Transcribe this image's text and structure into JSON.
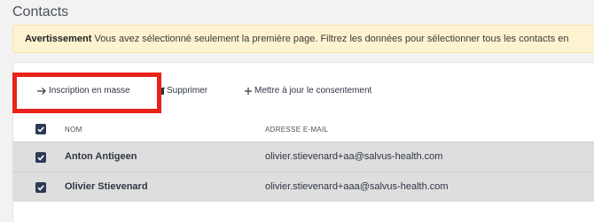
{
  "page": {
    "title": "Contacts"
  },
  "warning": {
    "label": "Avertissement",
    "message": " Vous avez sélectionné seulement la première page. Filtrez les données pour sélectionner tous les contacts en"
  },
  "toolbar": {
    "bulk_enroll": "Inscription en masse",
    "delete": "Supprimer",
    "update_consent": "Mettre à jour le consentement"
  },
  "table": {
    "headers": {
      "name": "NOM",
      "email": "ADRESSE E-MAIL"
    },
    "rows": [
      {
        "name": "Anton Antigeen",
        "email": "olivier.stievenard+aa@salvus-health.com",
        "checked": true
      },
      {
        "name": "Olivier Stievenard",
        "email": "olivier.stievenard+aaa@salvus-health.com",
        "checked": true
      }
    ]
  },
  "colors": {
    "highlight": "#e8231a",
    "checkbox": "#2b3a55",
    "warning_bg": "#fdf3d1"
  },
  "icons": {
    "bulk_enroll": "arrow-right-icon",
    "delete": "trash-icon",
    "update_consent": "plus-icon"
  }
}
